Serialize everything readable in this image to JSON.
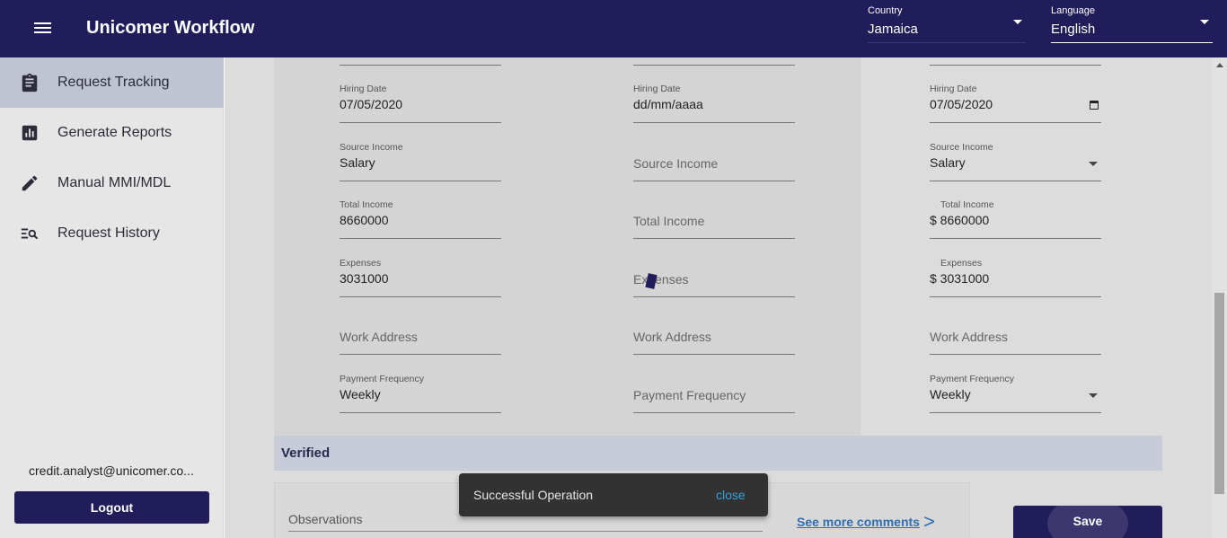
{
  "app": {
    "title": "Unicomer Workflow"
  },
  "topbar": {
    "country": {
      "label": "Country",
      "value": "Jamaica"
    },
    "language": {
      "label": "Language",
      "value": "English"
    }
  },
  "sidebar": {
    "items": [
      {
        "label": "Request Tracking",
        "icon": "clipboard-icon",
        "active": true
      },
      {
        "label": "Generate Reports",
        "icon": "report-chart-icon",
        "active": false
      },
      {
        "label": "Manual MMI/MDL",
        "icon": "pencil-icon",
        "active": false
      },
      {
        "label": "Request History",
        "icon": "search-list-icon",
        "active": false
      }
    ],
    "user_email": "credit.analyst@unicomer.co...",
    "logout_label": "Logout"
  },
  "form": {
    "col1": {
      "hiring_date": {
        "label": "Hiring Date",
        "value": "07/05/2020"
      },
      "source_income": {
        "label": "Source Income",
        "value": "Salary"
      },
      "total_income": {
        "label": "Total Income",
        "value": "8660000"
      },
      "expenses": {
        "label": "Expenses",
        "value": "3031000"
      },
      "work_address": {
        "placeholder": "Work Address"
      },
      "payment_frequency": {
        "label": "Payment Frequency",
        "value": "Weekly"
      }
    },
    "col2": {
      "hiring_date": {
        "label": "Hiring Date",
        "value": "dd/mm/aaaa"
      },
      "source_income": {
        "placeholder": "Source Income"
      },
      "total_income": {
        "placeholder": "Total Income"
      },
      "expenses": {
        "placeholder": "Expenses"
      },
      "work_address": {
        "placeholder": "Work Address"
      },
      "payment_frequency": {
        "placeholder": "Payment Frequency"
      }
    },
    "col3": {
      "hiring_date": {
        "label": "Hiring Date",
        "value": "07/05/2020"
      },
      "source_income": {
        "label": "Source Income",
        "value": "Salary"
      },
      "total_income": {
        "label": "Total Income",
        "value": "$ 8660000"
      },
      "expenses": {
        "label": "Expenses",
        "value": "$ 3031000"
      },
      "work_address": {
        "placeholder": "Work Address"
      },
      "payment_frequency": {
        "label": "Payment Frequency",
        "value": "Weekly"
      }
    }
  },
  "verified": {
    "title": "Verified"
  },
  "observations": {
    "placeholder": "Observations",
    "see_more_label": "See more comments",
    "see_more_arrow": ">"
  },
  "actions": {
    "save_label": "Save"
  },
  "toast": {
    "message": "Successful Operation",
    "close_label": "close"
  },
  "colors": {
    "primary": "#211c5a",
    "link": "#2f6fb0",
    "toast_bg": "#323232",
    "toast_action": "#39a0d8"
  }
}
